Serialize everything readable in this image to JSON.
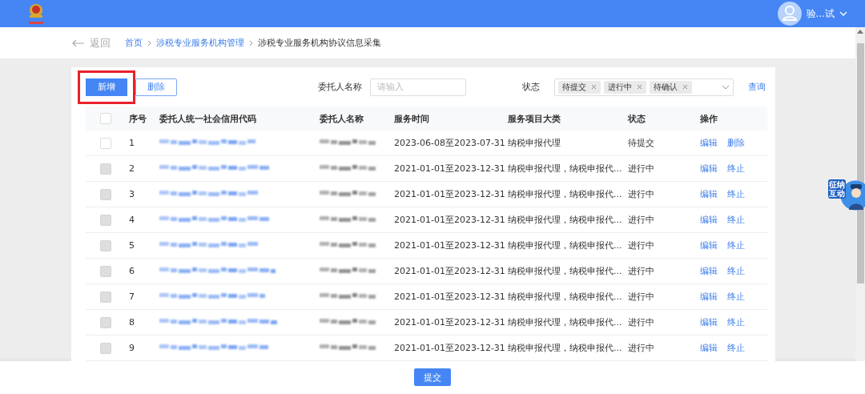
{
  "header": {
    "user_name": "验...试"
  },
  "breadcrumb": {
    "back": "返回",
    "items": [
      {
        "label": "首页",
        "link": true
      },
      {
        "label": "涉税专业服务机构管理",
        "link": true
      },
      {
        "label": "涉税专业服务机构协议信息采集",
        "link": false
      }
    ]
  },
  "toolbar": {
    "buttons": [
      {
        "label": "新增",
        "kind": "primary",
        "highlighted": true
      },
      {
        "label": "删除",
        "kind": "outline",
        "highlighted": false
      }
    ],
    "name_filter": {
      "label": "委托人名称",
      "placeholder": "请输入"
    },
    "status_filter": {
      "label": "状态",
      "tags": [
        "待提交",
        "进行中",
        "待确认"
      ]
    },
    "query": "查询"
  },
  "table": {
    "select_all": {
      "checked": false
    },
    "columns": [
      "序号",
      "委托人统一社会信用代码",
      "委托人名称",
      "服务时间",
      "服务项目大类",
      "状态",
      "操作"
    ],
    "rows": [
      {
        "disabled": false,
        "index": "1",
        "period": "2023-06-08至2023-07-31",
        "category": "纳税申报代理",
        "status": "待提交",
        "actions": [
          "编辑",
          "删除"
        ]
      },
      {
        "disabled": true,
        "index": "2",
        "period": "2021-01-01至2023-12-31",
        "category": "纳税申报代理，纳税申报代...",
        "status": "进行中",
        "actions": [
          "编辑",
          "终止"
        ]
      },
      {
        "disabled": true,
        "index": "3",
        "period": "2021-01-01至2023-12-31",
        "category": "纳税申报代理，纳税申报代...",
        "status": "进行中",
        "actions": [
          "编辑",
          "终止"
        ]
      },
      {
        "disabled": true,
        "index": "4",
        "period": "2021-01-01至2023-12-31",
        "category": "纳税申报代理，纳税申报代...",
        "status": "进行中",
        "actions": [
          "编辑",
          "终止"
        ]
      },
      {
        "disabled": true,
        "index": "5",
        "period": "2021-01-01至2023-12-31",
        "category": "纳税申报代理，纳税申报代...",
        "status": "进行中",
        "actions": [
          "编辑",
          "终止"
        ]
      },
      {
        "disabled": true,
        "index": "6",
        "period": "2021-01-01至2023-12-31",
        "category": "纳税申报代理，纳税申报代...",
        "status": "进行中",
        "actions": [
          "编辑",
          "终止"
        ]
      },
      {
        "disabled": true,
        "index": "7",
        "period": "2021-01-01至2023-12-31",
        "category": "纳税申报代理，纳税申报代...",
        "status": "进行中",
        "actions": [
          "编辑",
          "终止"
        ]
      },
      {
        "disabled": true,
        "index": "8",
        "period": "2021-01-01至2023-12-31",
        "category": "纳税申报代理，纳税申报代...",
        "status": "进行中",
        "actions": [
          "编辑",
          "终止"
        ]
      },
      {
        "disabled": true,
        "index": "9",
        "period": "2021-01-01至2023-12-31",
        "category": "纳税申报代理，纳税申报代...",
        "status": "进行中",
        "actions": [
          "编辑",
          "终止"
        ]
      }
    ]
  },
  "footer": {
    "submit": "提交"
  },
  "widget": {
    "label": "征纳互动"
  }
}
